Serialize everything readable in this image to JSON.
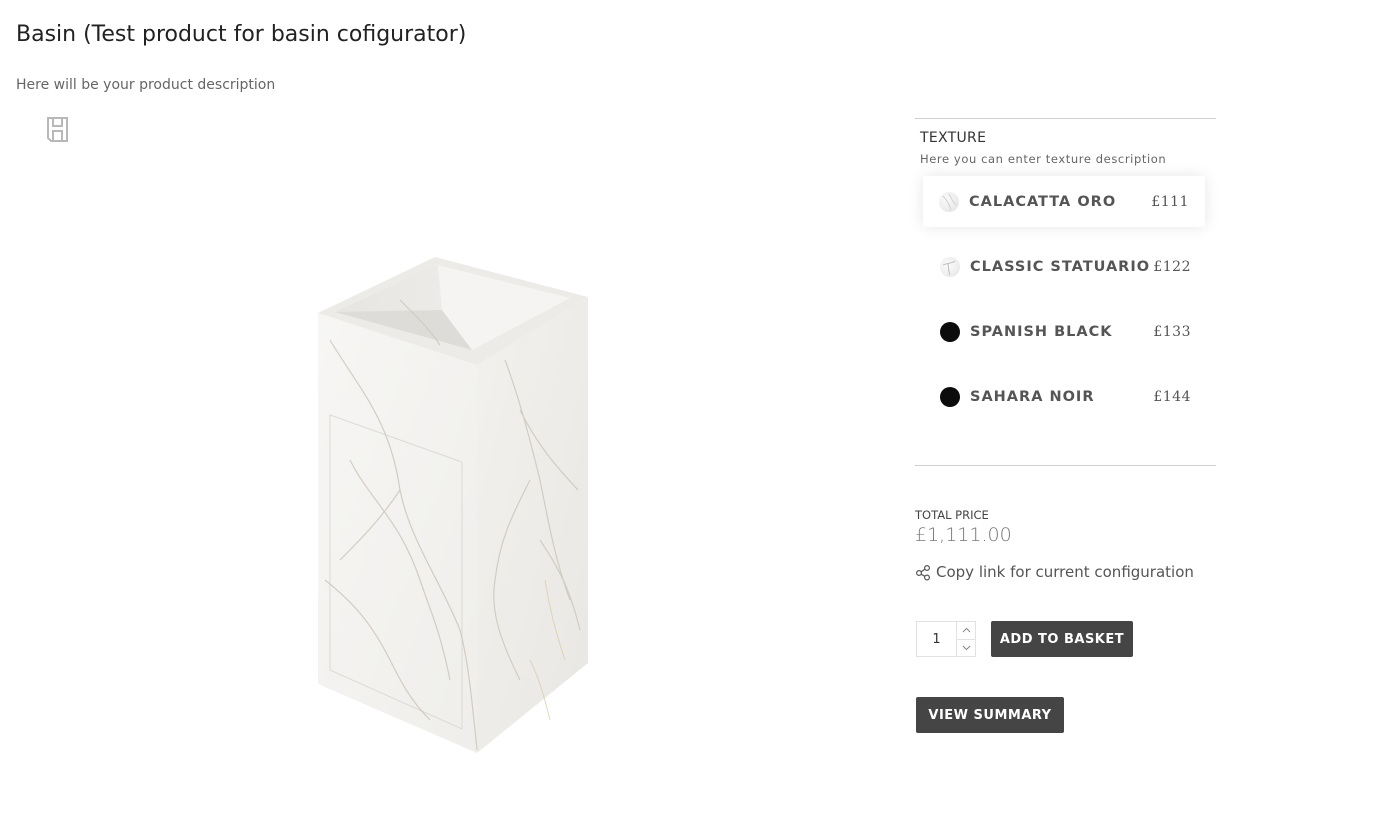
{
  "product": {
    "title": "Basin (Test product for basin cofigurator)",
    "description": "Here will be your product description",
    "image_alt": "Marble pedestal basin"
  },
  "icons": {
    "save": "save-icon",
    "share": "share-icon",
    "chevron_up": "chevron-up-icon",
    "chevron_down": "chevron-down-icon"
  },
  "texture": {
    "title": "TEXTURE",
    "description": "Here you can enter texture description",
    "options": [
      {
        "label": "CALACATTA ORO",
        "price": "£111",
        "swatch": "marble-light",
        "selected": true
      },
      {
        "label": "CLASSIC STATUARIO",
        "price": "£122",
        "swatch": "marble-white",
        "selected": false
      },
      {
        "label": "SPANISH BLACK",
        "price": "£133",
        "swatch": "black",
        "selected": false
      },
      {
        "label": "SAHARA NOIR",
        "price": "£144",
        "swatch": "black",
        "selected": false
      }
    ]
  },
  "pricing": {
    "total_label": "TOTAL PRICE",
    "total_value": "£1,111.00"
  },
  "actions": {
    "copy_link_label": "Copy link for current configuration",
    "quantity": "1",
    "add_to_basket_label": "ADD TO BASKET",
    "view_summary_label": "VIEW SUMMARY"
  },
  "colors": {
    "button_bg": "#454545",
    "divider": "#cfcfcf",
    "swatch_black": "#0c0c0c"
  }
}
